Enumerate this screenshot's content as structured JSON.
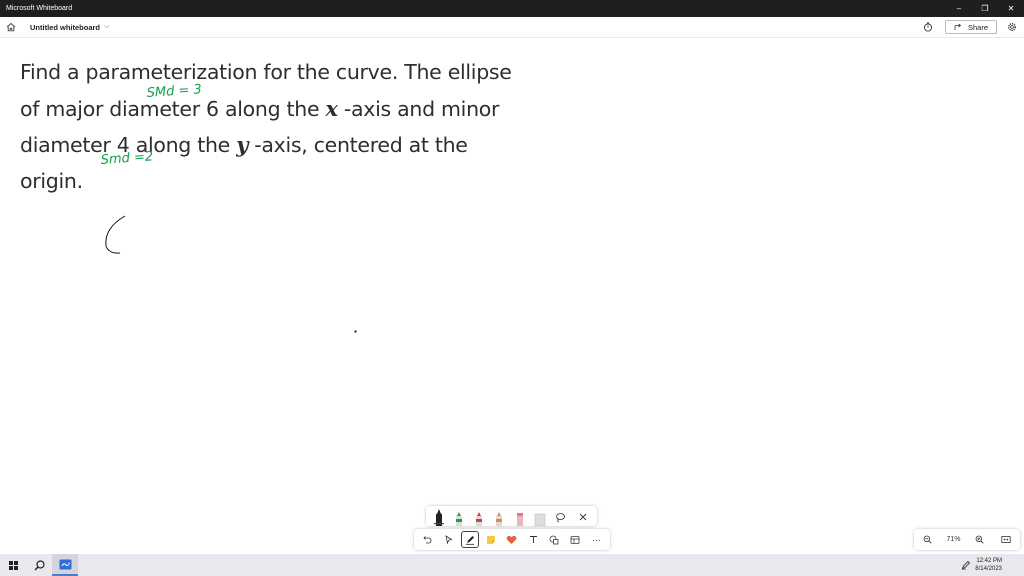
{
  "window": {
    "app_title": "Microsoft Whiteboard",
    "minimize": "–",
    "restore": "❐",
    "close": "✕"
  },
  "header": {
    "board_name": "Untitled whiteboard",
    "share_label": "Share"
  },
  "canvas": {
    "problem_lines": [
      "Find a parameterization for the curve. The ellipse",
      "of major diameter 6 along the ",
      " -axis and minor",
      "diameter 4 along the ",
      " -axis, centered at the",
      "origin."
    ],
    "math_x": "x",
    "math_y": "y",
    "annotations": {
      "smd3": "SMd = 3",
      "smd2": "Smd =2"
    }
  },
  "toolbar": {
    "more": "···"
  },
  "zoom": {
    "level": "71%"
  },
  "taskbar": {
    "time": "12:42 PM",
    "date": "8/14/2023"
  },
  "colors": {
    "ink_green": "#12a04a",
    "pen_black": "#222222",
    "pen_green": "#1f9e4a",
    "pen_red": "#d83b3b",
    "pen_orange": "#e8864a",
    "pen_pink": "#e37a8c",
    "highlighter": "#cfcfcf",
    "titlebar": "#1f1f1f",
    "taskbar": "#e8e8ee"
  },
  "icons": {
    "home": "home-icon",
    "timer": "timer-icon",
    "share": "share-icon",
    "settings": "gear-icon",
    "lasso": "lasso-icon",
    "undo": "undo-icon",
    "select": "pointer-icon",
    "pen": "pen-icon",
    "note": "sticky-note-icon",
    "reaction": "heart-icon",
    "text": "text-icon",
    "shapes": "shapes-icon",
    "template": "template-icon",
    "zoom_out": "zoom-out-icon",
    "zoom_in": "zoom-in-icon",
    "fit": "fit-screen-icon",
    "start": "windows-icon",
    "search": "search-icon",
    "whiteboard": "whiteboard-app-icon"
  }
}
